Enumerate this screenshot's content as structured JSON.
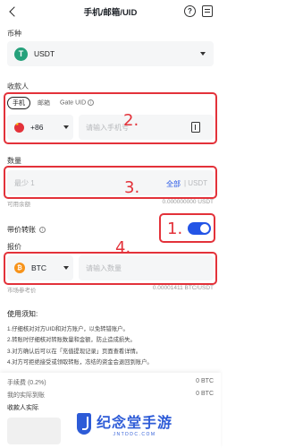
{
  "header": {
    "title": "手机/邮箱/UID",
    "help_icon": "?"
  },
  "coin": {
    "label": "币种",
    "name": "USDT",
    "logo_glyph": "T",
    "logo_color": "#26a17b"
  },
  "recipient": {
    "label": "收款人",
    "tabs": [
      {
        "label": "手机"
      },
      {
        "label": "邮箱"
      },
      {
        "label": "Gate UID"
      }
    ],
    "country_code": "+86",
    "phone_placeholder": "请输入手机号"
  },
  "amount": {
    "label": "数量",
    "placeholder": "最少 1",
    "all_label": "全部",
    "unit": "| USDT",
    "available_label": "可用余额",
    "available_value": "0.000000000 USDT"
  },
  "limit_transfer": {
    "label": "带价转账",
    "enabled": true
  },
  "price": {
    "label": "报价",
    "coin": "BTC",
    "coin_glyph": "₿",
    "placeholder": "请输入数量",
    "ref_label": "市场参考价",
    "ref_value": "0.00001411 BTC/USDT"
  },
  "notes": {
    "title": "使用须知:",
    "items": [
      "1.仔细核对对方UID和对方账户，以免转错账户。",
      "2.转账时仔细核对转账数量和金额，防止造成损失。",
      "3.对方确认后可以在「充值提现记录」页面查看详情。",
      "4.对方可拒绝接受或领取转账，冻结的资金会退回到账户。"
    ]
  },
  "footer": {
    "fee_label": "手续费 (0.2%)",
    "fee_value": "0 BTC",
    "actual_label": "我的实际到账",
    "actual_value": "0 BTC",
    "receiver_label": "收款人实际"
  },
  "annotations": [
    "2.",
    "3.",
    "1.",
    "4."
  ],
  "watermark": {
    "text": "纪念堂手游",
    "sub": "JNTDDC.COM"
  },
  "colors": {
    "accent": "#2354e6",
    "annotation_red": "#e3323a",
    "usdt": "#26a17b",
    "btc": "#f7931a"
  }
}
